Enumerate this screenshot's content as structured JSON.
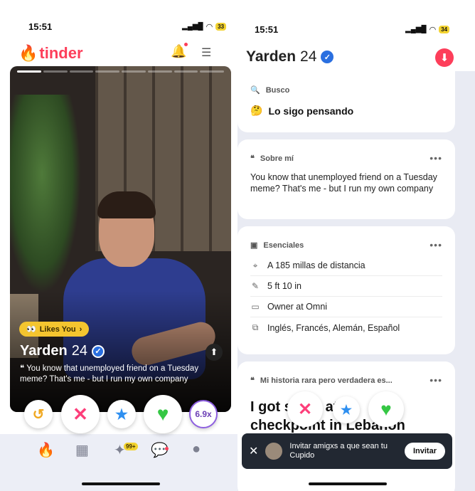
{
  "left": {
    "status": {
      "time": "15:51",
      "battery": "33"
    },
    "brand": "tinder",
    "card": {
      "likes_you": "Likes You",
      "name": "Yarden",
      "age": "24",
      "bio": "You know that unemployed friend on a Tuesday meme? That's me - but I run my own company"
    },
    "actions": {
      "rewind": "↺",
      "nope": "✕",
      "super": "★",
      "like": "♥",
      "multiplier": "6.9x"
    },
    "nav": {
      "explore_badge": "99+"
    }
  },
  "right": {
    "status": {
      "time": "15:51",
      "battery": "34"
    },
    "name": "Yarden",
    "age": "24",
    "looking": {
      "label": "Busco",
      "value": "Lo sigo pensando",
      "emoji": "🤔"
    },
    "about": {
      "label": "Sobre mí",
      "text": "You know that unemployed friend on a Tuesday meme? That's me - but I run my own company"
    },
    "essentials": {
      "label": "Esenciales",
      "items": [
        {
          "icon": "location-icon",
          "text": "A 185 millas de distancia"
        },
        {
          "icon": "ruler-icon",
          "text": "5 ft 10 in"
        },
        {
          "icon": "briefcase-icon",
          "text": "Owner at Omni"
        },
        {
          "icon": "language-icon",
          "text": "Inglés, Francés, Alemán, Español"
        }
      ]
    },
    "story": {
      "label": "Mi historia rara pero verdadera es...",
      "text": "I got stuck at a checkpoint in Lebanon"
    },
    "toast": {
      "text": "Invitar amigxs a que sean tu Cupido",
      "button": "Invitar"
    }
  }
}
